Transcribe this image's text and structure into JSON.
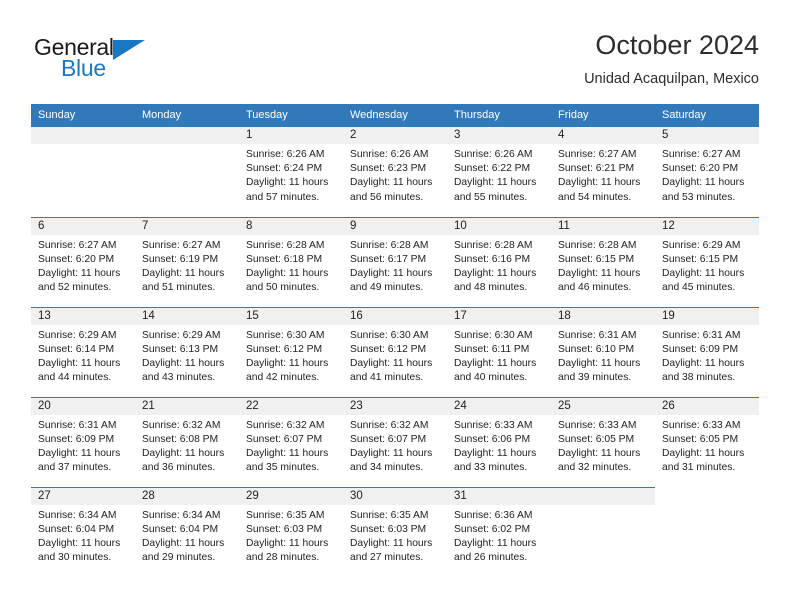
{
  "brand": {
    "name_part1": "General",
    "name_part2": "Blue",
    "accent_color": "#1878c4",
    "header_color": "#3179b8"
  },
  "header": {
    "title": "October 2024",
    "subtitle": "Unidad Acaquilpan, Mexico"
  },
  "weekdays": [
    "Sunday",
    "Monday",
    "Tuesday",
    "Wednesday",
    "Thursday",
    "Friday",
    "Saturday"
  ],
  "labels": {
    "sunrise": "Sunrise:",
    "sunset": "Sunset:",
    "daylight": "Daylight:"
  },
  "weeks": [
    [
      {
        "day": "",
        "sunrise": "",
        "sunset": "",
        "daylight_line1": "",
        "daylight_line2": "",
        "blank": true
      },
      {
        "day": "",
        "sunrise": "",
        "sunset": "",
        "daylight_line1": "",
        "daylight_line2": "",
        "blank": true
      },
      {
        "day": "1",
        "sunrise": "Sunrise: 6:26 AM",
        "sunset": "Sunset: 6:24 PM",
        "daylight_line1": "Daylight: 11 hours",
        "daylight_line2": "and 57 minutes."
      },
      {
        "day": "2",
        "sunrise": "Sunrise: 6:26 AM",
        "sunset": "Sunset: 6:23 PM",
        "daylight_line1": "Daylight: 11 hours",
        "daylight_line2": "and 56 minutes."
      },
      {
        "day": "3",
        "sunrise": "Sunrise: 6:26 AM",
        "sunset": "Sunset: 6:22 PM",
        "daylight_line1": "Daylight: 11 hours",
        "daylight_line2": "and 55 minutes."
      },
      {
        "day": "4",
        "sunrise": "Sunrise: 6:27 AM",
        "sunset": "Sunset: 6:21 PM",
        "daylight_line1": "Daylight: 11 hours",
        "daylight_line2": "and 54 minutes."
      },
      {
        "day": "5",
        "sunrise": "Sunrise: 6:27 AM",
        "sunset": "Sunset: 6:20 PM",
        "daylight_line1": "Daylight: 11 hours",
        "daylight_line2": "and 53 minutes."
      }
    ],
    [
      {
        "day": "6",
        "sunrise": "Sunrise: 6:27 AM",
        "sunset": "Sunset: 6:20 PM",
        "daylight_line1": "Daylight: 11 hours",
        "daylight_line2": "and 52 minutes."
      },
      {
        "day": "7",
        "sunrise": "Sunrise: 6:27 AM",
        "sunset": "Sunset: 6:19 PM",
        "daylight_line1": "Daylight: 11 hours",
        "daylight_line2": "and 51 minutes."
      },
      {
        "day": "8",
        "sunrise": "Sunrise: 6:28 AM",
        "sunset": "Sunset: 6:18 PM",
        "daylight_line1": "Daylight: 11 hours",
        "daylight_line2": "and 50 minutes."
      },
      {
        "day": "9",
        "sunrise": "Sunrise: 6:28 AM",
        "sunset": "Sunset: 6:17 PM",
        "daylight_line1": "Daylight: 11 hours",
        "daylight_line2": "and 49 minutes."
      },
      {
        "day": "10",
        "sunrise": "Sunrise: 6:28 AM",
        "sunset": "Sunset: 6:16 PM",
        "daylight_line1": "Daylight: 11 hours",
        "daylight_line2": "and 48 minutes."
      },
      {
        "day": "11",
        "sunrise": "Sunrise: 6:28 AM",
        "sunset": "Sunset: 6:15 PM",
        "daylight_line1": "Daylight: 11 hours",
        "daylight_line2": "and 46 minutes."
      },
      {
        "day": "12",
        "sunrise": "Sunrise: 6:29 AM",
        "sunset": "Sunset: 6:15 PM",
        "daylight_line1": "Daylight: 11 hours",
        "daylight_line2": "and 45 minutes."
      }
    ],
    [
      {
        "day": "13",
        "sunrise": "Sunrise: 6:29 AM",
        "sunset": "Sunset: 6:14 PM",
        "daylight_line1": "Daylight: 11 hours",
        "daylight_line2": "and 44 minutes."
      },
      {
        "day": "14",
        "sunrise": "Sunrise: 6:29 AM",
        "sunset": "Sunset: 6:13 PM",
        "daylight_line1": "Daylight: 11 hours",
        "daylight_line2": "and 43 minutes."
      },
      {
        "day": "15",
        "sunrise": "Sunrise: 6:30 AM",
        "sunset": "Sunset: 6:12 PM",
        "daylight_line1": "Daylight: 11 hours",
        "daylight_line2": "and 42 minutes."
      },
      {
        "day": "16",
        "sunrise": "Sunrise: 6:30 AM",
        "sunset": "Sunset: 6:12 PM",
        "daylight_line1": "Daylight: 11 hours",
        "daylight_line2": "and 41 minutes."
      },
      {
        "day": "17",
        "sunrise": "Sunrise: 6:30 AM",
        "sunset": "Sunset: 6:11 PM",
        "daylight_line1": "Daylight: 11 hours",
        "daylight_line2": "and 40 minutes."
      },
      {
        "day": "18",
        "sunrise": "Sunrise: 6:31 AM",
        "sunset": "Sunset: 6:10 PM",
        "daylight_line1": "Daylight: 11 hours",
        "daylight_line2": "and 39 minutes."
      },
      {
        "day": "19",
        "sunrise": "Sunrise: 6:31 AM",
        "sunset": "Sunset: 6:09 PM",
        "daylight_line1": "Daylight: 11 hours",
        "daylight_line2": "and 38 minutes."
      }
    ],
    [
      {
        "day": "20",
        "sunrise": "Sunrise: 6:31 AM",
        "sunset": "Sunset: 6:09 PM",
        "daylight_line1": "Daylight: 11 hours",
        "daylight_line2": "and 37 minutes."
      },
      {
        "day": "21",
        "sunrise": "Sunrise: 6:32 AM",
        "sunset": "Sunset: 6:08 PM",
        "daylight_line1": "Daylight: 11 hours",
        "daylight_line2": "and 36 minutes."
      },
      {
        "day": "22",
        "sunrise": "Sunrise: 6:32 AM",
        "sunset": "Sunset: 6:07 PM",
        "daylight_line1": "Daylight: 11 hours",
        "daylight_line2": "and 35 minutes."
      },
      {
        "day": "23",
        "sunrise": "Sunrise: 6:32 AM",
        "sunset": "Sunset: 6:07 PM",
        "daylight_line1": "Daylight: 11 hours",
        "daylight_line2": "and 34 minutes."
      },
      {
        "day": "24",
        "sunrise": "Sunrise: 6:33 AM",
        "sunset": "Sunset: 6:06 PM",
        "daylight_line1": "Daylight: 11 hours",
        "daylight_line2": "and 33 minutes."
      },
      {
        "day": "25",
        "sunrise": "Sunrise: 6:33 AM",
        "sunset": "Sunset: 6:05 PM",
        "daylight_line1": "Daylight: 11 hours",
        "daylight_line2": "and 32 minutes."
      },
      {
        "day": "26",
        "sunrise": "Sunrise: 6:33 AM",
        "sunset": "Sunset: 6:05 PM",
        "daylight_line1": "Daylight: 11 hours",
        "daylight_line2": "and 31 minutes."
      }
    ],
    [
      {
        "day": "27",
        "sunrise": "Sunrise: 6:34 AM",
        "sunset": "Sunset: 6:04 PM",
        "daylight_line1": "Daylight: 11 hours",
        "daylight_line2": "and 30 minutes."
      },
      {
        "day": "28",
        "sunrise": "Sunrise: 6:34 AM",
        "sunset": "Sunset: 6:04 PM",
        "daylight_line1": "Daylight: 11 hours",
        "daylight_line2": "and 29 minutes."
      },
      {
        "day": "29",
        "sunrise": "Sunrise: 6:35 AM",
        "sunset": "Sunset: 6:03 PM",
        "daylight_line1": "Daylight: 11 hours",
        "daylight_line2": "and 28 minutes."
      },
      {
        "day": "30",
        "sunrise": "Sunrise: 6:35 AM",
        "sunset": "Sunset: 6:03 PM",
        "daylight_line1": "Daylight: 11 hours",
        "daylight_line2": "and 27 minutes."
      },
      {
        "day": "31",
        "sunrise": "Sunrise: 6:36 AM",
        "sunset": "Sunset: 6:02 PM",
        "daylight_line1": "Daylight: 11 hours",
        "daylight_line2": "and 26 minutes."
      },
      {
        "day": "",
        "sunrise": "",
        "sunset": "",
        "daylight_line1": "",
        "daylight_line2": "",
        "blank": true
      },
      {
        "day": "",
        "sunrise": "",
        "sunset": "",
        "daylight_line1": "",
        "daylight_line2": "",
        "void": true
      }
    ]
  ]
}
